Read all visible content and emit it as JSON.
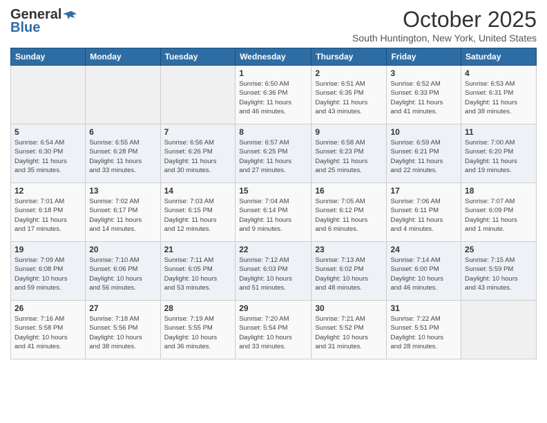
{
  "logo": {
    "general": "General",
    "blue": "Blue"
  },
  "title": "October 2025",
  "subtitle": "South Huntington, New York, United States",
  "days_header": [
    "Sunday",
    "Monday",
    "Tuesday",
    "Wednesday",
    "Thursday",
    "Friday",
    "Saturday"
  ],
  "weeks": [
    [
      {
        "day": "",
        "info": ""
      },
      {
        "day": "",
        "info": ""
      },
      {
        "day": "",
        "info": ""
      },
      {
        "day": "1",
        "info": "Sunrise: 6:50 AM\nSunset: 6:36 PM\nDaylight: 11 hours\nand 46 minutes."
      },
      {
        "day": "2",
        "info": "Sunrise: 6:51 AM\nSunset: 6:35 PM\nDaylight: 11 hours\nand 43 minutes."
      },
      {
        "day": "3",
        "info": "Sunrise: 6:52 AM\nSunset: 6:33 PM\nDaylight: 11 hours\nand 41 minutes."
      },
      {
        "day": "4",
        "info": "Sunrise: 6:53 AM\nSunset: 6:31 PM\nDaylight: 11 hours\nand 38 minutes."
      }
    ],
    [
      {
        "day": "5",
        "info": "Sunrise: 6:54 AM\nSunset: 6:30 PM\nDaylight: 11 hours\nand 35 minutes."
      },
      {
        "day": "6",
        "info": "Sunrise: 6:55 AM\nSunset: 6:28 PM\nDaylight: 11 hours\nand 33 minutes."
      },
      {
        "day": "7",
        "info": "Sunrise: 6:56 AM\nSunset: 6:26 PM\nDaylight: 11 hours\nand 30 minutes."
      },
      {
        "day": "8",
        "info": "Sunrise: 6:57 AM\nSunset: 6:25 PM\nDaylight: 11 hours\nand 27 minutes."
      },
      {
        "day": "9",
        "info": "Sunrise: 6:58 AM\nSunset: 6:23 PM\nDaylight: 11 hours\nand 25 minutes."
      },
      {
        "day": "10",
        "info": "Sunrise: 6:59 AM\nSunset: 6:21 PM\nDaylight: 11 hours\nand 22 minutes."
      },
      {
        "day": "11",
        "info": "Sunrise: 7:00 AM\nSunset: 6:20 PM\nDaylight: 11 hours\nand 19 minutes."
      }
    ],
    [
      {
        "day": "12",
        "info": "Sunrise: 7:01 AM\nSunset: 6:18 PM\nDaylight: 11 hours\nand 17 minutes."
      },
      {
        "day": "13",
        "info": "Sunrise: 7:02 AM\nSunset: 6:17 PM\nDaylight: 11 hours\nand 14 minutes."
      },
      {
        "day": "14",
        "info": "Sunrise: 7:03 AM\nSunset: 6:15 PM\nDaylight: 11 hours\nand 12 minutes."
      },
      {
        "day": "15",
        "info": "Sunrise: 7:04 AM\nSunset: 6:14 PM\nDaylight: 11 hours\nand 9 minutes."
      },
      {
        "day": "16",
        "info": "Sunrise: 7:05 AM\nSunset: 6:12 PM\nDaylight: 11 hours\nand 6 minutes."
      },
      {
        "day": "17",
        "info": "Sunrise: 7:06 AM\nSunset: 6:11 PM\nDaylight: 11 hours\nand 4 minutes."
      },
      {
        "day": "18",
        "info": "Sunrise: 7:07 AM\nSunset: 6:09 PM\nDaylight: 11 hours\nand 1 minute."
      }
    ],
    [
      {
        "day": "19",
        "info": "Sunrise: 7:09 AM\nSunset: 6:08 PM\nDaylight: 10 hours\nand 59 minutes."
      },
      {
        "day": "20",
        "info": "Sunrise: 7:10 AM\nSunset: 6:06 PM\nDaylight: 10 hours\nand 56 minutes."
      },
      {
        "day": "21",
        "info": "Sunrise: 7:11 AM\nSunset: 6:05 PM\nDaylight: 10 hours\nand 53 minutes."
      },
      {
        "day": "22",
        "info": "Sunrise: 7:12 AM\nSunset: 6:03 PM\nDaylight: 10 hours\nand 51 minutes."
      },
      {
        "day": "23",
        "info": "Sunrise: 7:13 AM\nSunset: 6:02 PM\nDaylight: 10 hours\nand 48 minutes."
      },
      {
        "day": "24",
        "info": "Sunrise: 7:14 AM\nSunset: 6:00 PM\nDaylight: 10 hours\nand 46 minutes."
      },
      {
        "day": "25",
        "info": "Sunrise: 7:15 AM\nSunset: 5:59 PM\nDaylight: 10 hours\nand 43 minutes."
      }
    ],
    [
      {
        "day": "26",
        "info": "Sunrise: 7:16 AM\nSunset: 5:58 PM\nDaylight: 10 hours\nand 41 minutes."
      },
      {
        "day": "27",
        "info": "Sunrise: 7:18 AM\nSunset: 5:56 PM\nDaylight: 10 hours\nand 38 minutes."
      },
      {
        "day": "28",
        "info": "Sunrise: 7:19 AM\nSunset: 5:55 PM\nDaylight: 10 hours\nand 36 minutes."
      },
      {
        "day": "29",
        "info": "Sunrise: 7:20 AM\nSunset: 5:54 PM\nDaylight: 10 hours\nand 33 minutes."
      },
      {
        "day": "30",
        "info": "Sunrise: 7:21 AM\nSunset: 5:52 PM\nDaylight: 10 hours\nand 31 minutes."
      },
      {
        "day": "31",
        "info": "Sunrise: 7:22 AM\nSunset: 5:51 PM\nDaylight: 10 hours\nand 28 minutes."
      },
      {
        "day": "",
        "info": ""
      }
    ]
  ]
}
